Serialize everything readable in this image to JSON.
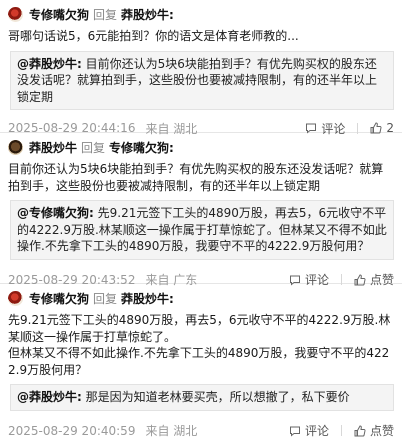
{
  "comments": [
    {
      "user": "专修嘴欠狗",
      "reply_word": "回复",
      "reply_to": "莽股炒牛:",
      "text": "哥哪句话说5，6元能拍到？你的语文是体育老师教的...",
      "quote_user": "@莽股炒牛:",
      "quote_text": "目前你还认为5块6块能拍到手？有优先购买权的股东还没发话呢？就算拍到手，这些股份也要被减持限制，有的还半年以上锁定期",
      "time": "2025-08-29 20:44:16",
      "location": "来自 湖北",
      "comment_label": "评论",
      "like_count": "2"
    },
    {
      "user": "莽股炒牛",
      "reply_word": "回复",
      "reply_to": "专修嘴欠狗:",
      "text": "目前你还认为5块6块能拍到手？有优先购买权的股东还没发话呢？就算拍到手，这些股份也要被减持限制，有的还半年以上锁定期",
      "quote_user": "@专修嘴欠狗:",
      "quote_text": "先9.21元签下工头的4890万股，再去5，6元收守不平的4222.9万股.林某顺这一操作属于打草惊蛇了。但林某又不得不如此操作.不先拿下工头的4890万股，我要守不平的4222.9万股何用？",
      "time": "2025-08-29 20:43:52",
      "location": "来自 广东",
      "comment_label": "评论",
      "like_label": "点赞"
    },
    {
      "user": "专修嘴欠狗",
      "reply_word": "回复",
      "reply_to": "莽股炒牛:",
      "text": "先9.21元签下工头的4890万股，再去5，6元收守不平的4222.9万股.林某顺这一操作属于打草惊蛇了。\n但林某又不得不如此操作.不先拿下工头的4890万股，我要守不平的4222.9万股何用？",
      "quote_user": "@莽股炒牛:",
      "quote_text": "那是因为知道老林要买壳，所以想撤了，私下要价",
      "time": "2025-08-29 20:40:59",
      "location": "来自 湖北",
      "comment_label": "评论",
      "like_label": "点赞"
    }
  ],
  "colors": {
    "name": "#111111",
    "muted": "#9a9a9a",
    "quote_bg": "#f4f4f4"
  }
}
